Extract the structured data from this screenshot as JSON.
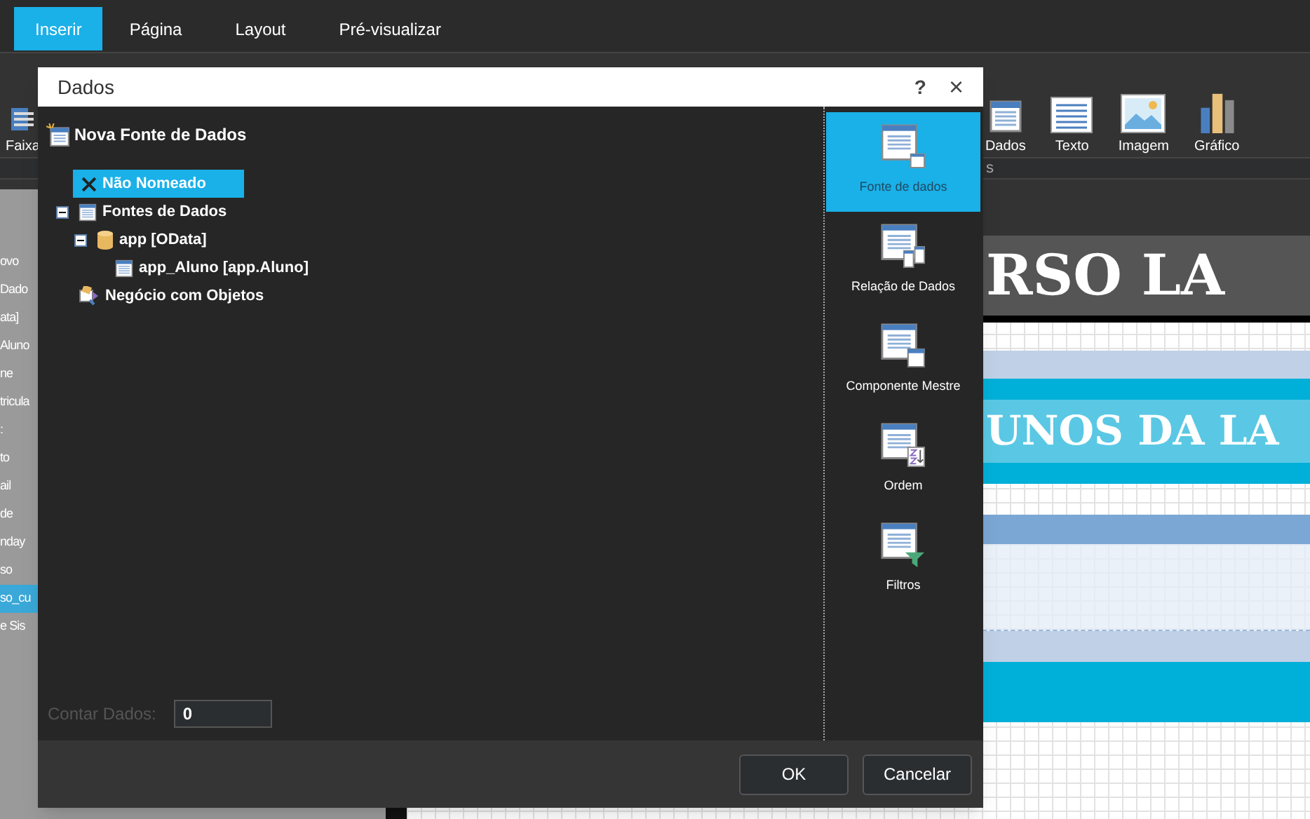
{
  "tabs": [
    {
      "label": "Inserir",
      "selected": true
    },
    {
      "label": "Página",
      "selected": false
    },
    {
      "label": "Layout",
      "selected": false
    },
    {
      "label": "Pré-visualizar",
      "selected": false
    }
  ],
  "toolbar": {
    "items": [
      {
        "label": "Faixa",
        "kind": "band"
      },
      {
        "label": "Dados",
        "kind": "data"
      },
      {
        "label": "Texto",
        "kind": "text"
      },
      {
        "label": "Imagem",
        "kind": "image"
      },
      {
        "label": "Gráfico",
        "kind": "chart"
      }
    ],
    "strip_text": "s"
  },
  "left_panel": {
    "items": [
      {
        "text": "ovo",
        "selected": false
      },
      {
        "text": "Dado",
        "selected": false
      },
      {
        "text": "ata]",
        "selected": false
      },
      {
        "text": "Aluno",
        "selected": false
      },
      {
        "text": "ne",
        "selected": false
      },
      {
        "text": "tricula",
        "selected": false
      },
      {
        "text": ":",
        "selected": false
      },
      {
        "text": "to",
        "selected": false
      },
      {
        "text": "ail",
        "selected": false
      },
      {
        "text": "de",
        "selected": false
      },
      {
        "text": "nday",
        "selected": false
      },
      {
        "text": "so",
        "selected": false
      },
      {
        "text": "so_cu",
        "selected": true
      },
      {
        "text": "e Sis",
        "selected": false
      }
    ]
  },
  "report": {
    "titles": [
      {
        "text": "RSO LA"
      },
      {
        "text": "UNOS DA LA"
      }
    ]
  },
  "dialog": {
    "title": "Dados",
    "help": "?",
    "close": "×",
    "header": "Nova Fonte de Dados",
    "tree": [
      {
        "label": "Não Nomeado",
        "kind": "unnamed",
        "selected": true
      },
      {
        "label": "Fontes de Dados",
        "kind": "group",
        "selected": false,
        "expanded": true,
        "children": [
          {
            "label": "app [OData]",
            "kind": "database",
            "selected": false,
            "expanded": true,
            "children": [
              {
                "label": "app_Aluno [app.Aluno]",
                "kind": "table",
                "selected": false
              }
            ]
          }
        ]
      },
      {
        "label": "Negócio com Objetos",
        "kind": "business",
        "selected": false
      }
    ],
    "count": {
      "label": "Contar Dados:",
      "value": "0"
    },
    "actions": [
      {
        "label": "Fonte de dados",
        "kind": "source",
        "selected": true
      },
      {
        "label": "Relação de Dados",
        "kind": "relation",
        "selected": false
      },
      {
        "label": "Componente Mestre",
        "kind": "master",
        "selected": false
      },
      {
        "label": "Ordem",
        "kind": "sort",
        "selected": false
      },
      {
        "label": "Filtros",
        "kind": "filter",
        "selected": false
      }
    ],
    "buttons": [
      "OK",
      "Cancelar"
    ]
  }
}
